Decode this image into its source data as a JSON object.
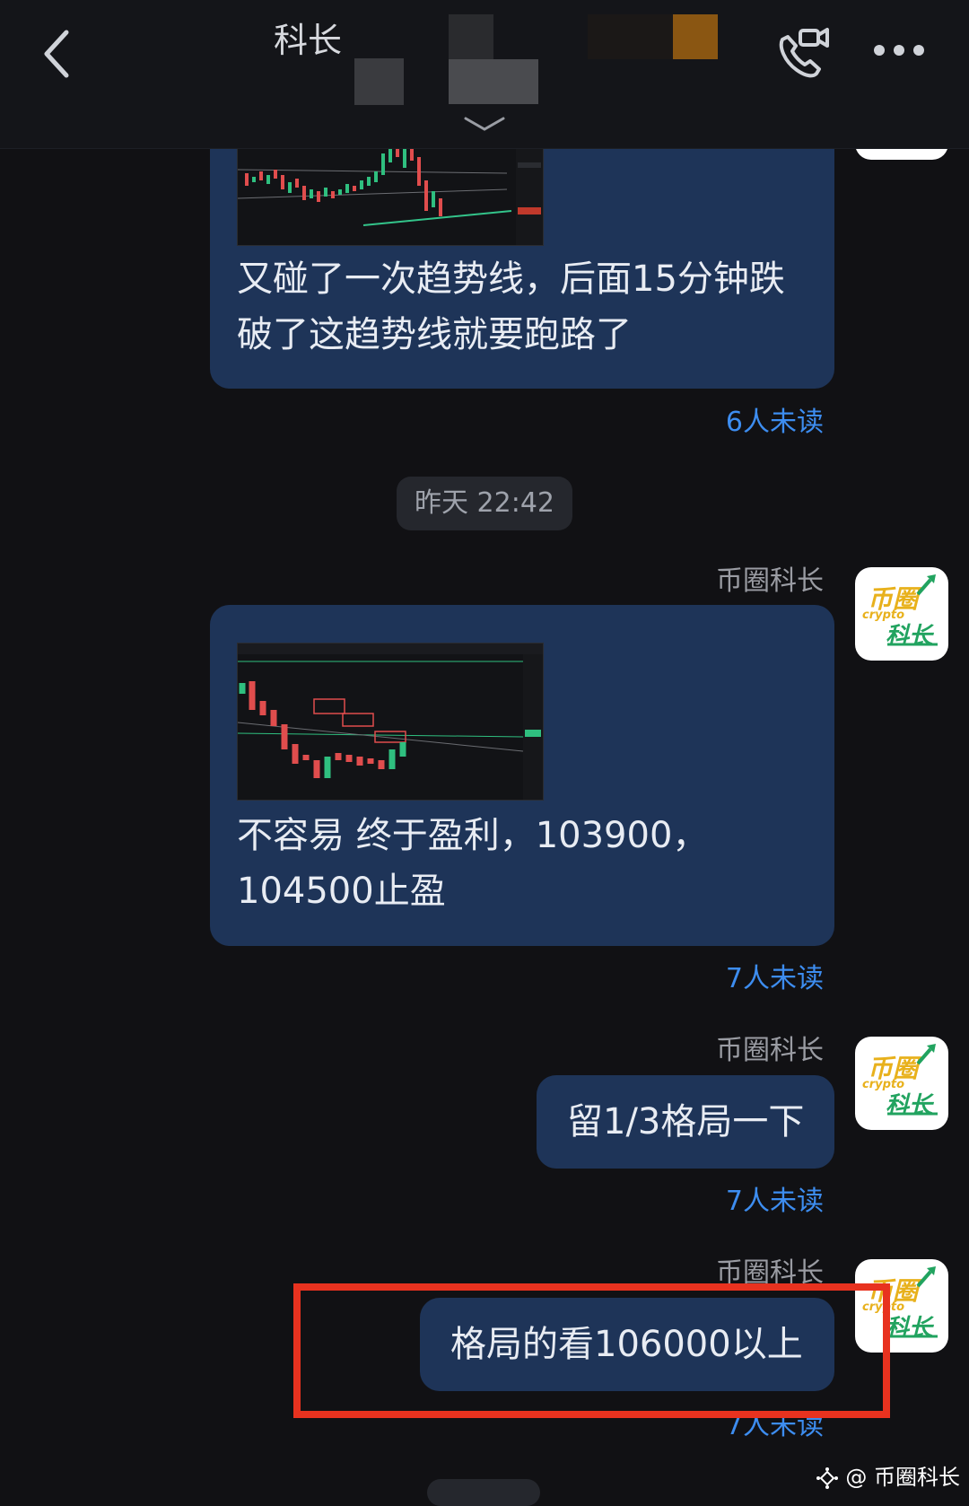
{
  "header": {
    "title": "科长",
    "back_icon": "chevron-left-icon",
    "call_icon": "video-call-icon",
    "more_icon": "more-dots-icon",
    "expand_icon": "chevron-down-icon"
  },
  "messages": [
    {
      "text_line1": "又碰了一次趋势线，后面15分钟跌",
      "text_line2": "破了这趋势线就要跑路了",
      "unread": "6人未读"
    },
    {
      "sender": "币圈科长",
      "text_line1": "不容易 终于盈利，103900，",
      "text_line2": "104500止盈",
      "unread": "7人未读"
    },
    {
      "sender": "币圈科长",
      "text": "留1/3格局一下",
      "unread": "7人未读"
    },
    {
      "sender": "币圈科长",
      "text": "格局的看106000以上",
      "unread": "7人未读"
    }
  ],
  "time_divider": "昨天 22:42",
  "avatar": {
    "line1": "币圈",
    "line2": "crypto",
    "line3": "科长"
  },
  "watermark": "@ 币圈科长",
  "colors": {
    "bubble": "#1e3458",
    "unread": "#3d8df0",
    "highlight": "#e8321f",
    "background": "#111114"
  }
}
